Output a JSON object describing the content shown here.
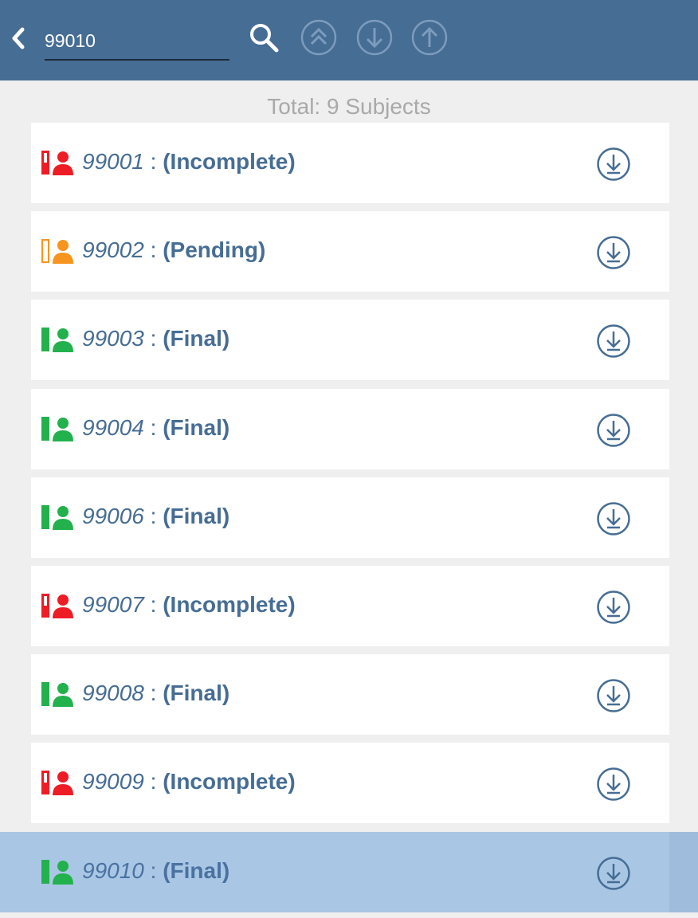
{
  "header": {
    "search_value": "99010",
    "icons": [
      "chevron-left-icon",
      "search-icon",
      "double-chevron-up-circle-icon",
      "arrow-down-circle-icon",
      "arrow-up-circle-icon"
    ]
  },
  "total_label": "Total: 9 Subjects",
  "colors": {
    "header_bg": "#466d94",
    "incomplete": "#ee1c25",
    "pending": "#f7941d",
    "final": "#22b14c",
    "text": "#466d94",
    "selected_bg": "#a9c7e5"
  },
  "subjects": [
    {
      "id": "99001",
      "sep": " : ",
      "status": "(Incomplete)",
      "state": "incomplete"
    },
    {
      "id": "99002",
      "sep": " : ",
      "status": "(Pending)",
      "state": "pending"
    },
    {
      "id": "99003",
      "sep": " : ",
      "status": "(Final)",
      "state": "final"
    },
    {
      "id": "99004",
      "sep": " : ",
      "status": "(Final)",
      "state": "final"
    },
    {
      "id": "99006",
      "sep": " : ",
      "status": "(Final)",
      "state": "final"
    },
    {
      "id": "99007",
      "sep": " : ",
      "status": "(Incomplete)",
      "state": "incomplete"
    },
    {
      "id": "99008",
      "sep": " : ",
      "status": "(Final)",
      "state": "final"
    },
    {
      "id": "99009",
      "sep": " : ",
      "status": "(Incomplete)",
      "state": "incomplete"
    },
    {
      "id": "99010",
      "sep": " : ",
      "status": "(Final)",
      "state": "final",
      "selected": true
    }
  ]
}
